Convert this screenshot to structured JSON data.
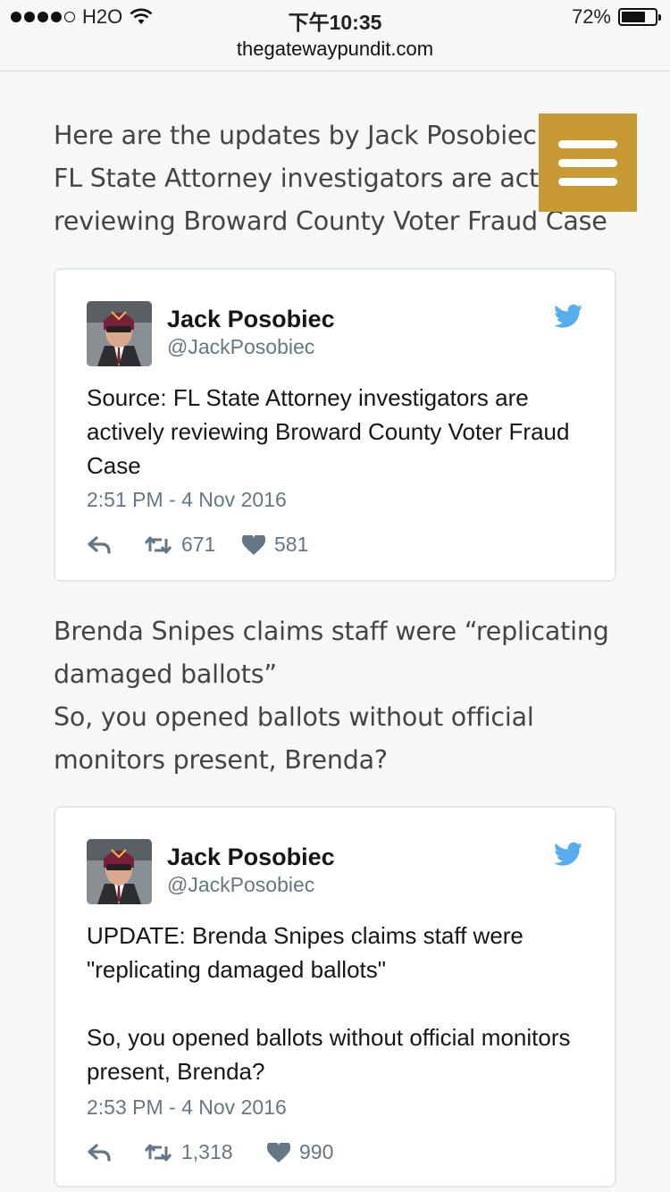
{
  "status_bar": {
    "carrier": "H2O",
    "time": "下午10:35",
    "battery_percent": "72%",
    "battery_level": 0.72
  },
  "url_bar": {
    "domain": "thegatewaypundit.com"
  },
  "menu": {
    "icon": "hamburger-menu-icon",
    "color": "#c99a34"
  },
  "paragraphs": [
    {
      "text": "Here are the updates by Jack Posobiec:\nFL State Attorney investigators are actively reviewing Broward County Voter Fraud Case"
    },
    {
      "text": "Brenda Snipes claims staff were “replicating damaged ballots”\nSo, you opened ballots without official monitors present, Brenda?"
    }
  ],
  "tweets": [
    {
      "name": "Jack Posobiec",
      "handle": "@JackPosobiec",
      "text": "Source: FL State Attorney investigators are actively reviewing Broward County Voter Fraud Case",
      "time": "2:51 PM - 4 Nov 2016",
      "retweets": "671",
      "likes": "581"
    },
    {
      "name": "Jack Posobiec",
      "handle": "@JackPosobiec",
      "text": "UPDATE: Brenda Snipes claims staff were \"replicating damaged ballots\"\n\nSo, you opened ballots without official monitors present, Brenda?",
      "time": "2:53 PM - 4 Nov 2016",
      "retweets": "1,318",
      "likes": "990"
    }
  ],
  "colors": {
    "twitter_blue": "#55acee",
    "meta_gray": "#657786"
  }
}
